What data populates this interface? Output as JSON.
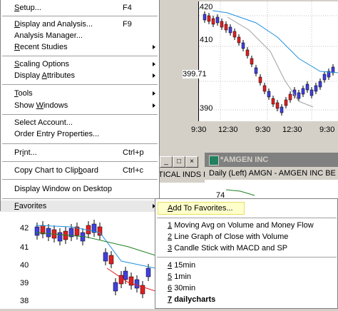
{
  "colors": {
    "up": "#4040e0",
    "down": "#e02020",
    "ma_fast": "#2090e0",
    "ma_slow": "#a0a0a0",
    "ma_green": "#208020",
    "highlight": "#ffffcc"
  },
  "chart_top": {
    "y_ticks": [
      "420",
      "410",
      "399.71",
      "390"
    ],
    "x_ticks": [
      "9:30",
      "12:30",
      "9:30",
      "12:30",
      "9:30"
    ]
  },
  "chart_bl": {
    "y_ticks": [
      "42",
      "41",
      "40",
      "39",
      "38"
    ]
  },
  "amgen": {
    "title": "*AMGEN INC",
    "sub": "Daily  (Left)    AMGN - AMGEN INC  BE",
    "value": "74"
  },
  "mid_window": {
    "label": "TICAL INDS L",
    "controls": [
      "_",
      "□",
      "×"
    ]
  },
  "menu": {
    "items": [
      {
        "label": "Setup...",
        "shortcut": "F4",
        "u": "S"
      },
      {
        "label": "Display and Analysis...",
        "shortcut": "F9",
        "u": "D"
      },
      {
        "label": "Analysis Manager...",
        "shortcut": "",
        "u": ""
      },
      {
        "label": "Recent Studies",
        "shortcut": "",
        "u": "R",
        "arrow": true
      },
      {
        "label": "Scaling Options",
        "shortcut": "",
        "u": "S",
        "arrow": true
      },
      {
        "label": "Display Attributes",
        "shortcut": "",
        "u": "A",
        "arrow": true
      },
      {
        "label": "Tools",
        "shortcut": "",
        "u": "T",
        "arrow": true
      },
      {
        "label": "Show Windows",
        "shortcut": "",
        "u": "W",
        "arrow": true
      },
      {
        "label": "Select Account...",
        "shortcut": "",
        "u": ""
      },
      {
        "label": "Order Entry Properties...",
        "shortcut": "",
        "u": ""
      },
      {
        "label": "Print...",
        "shortcut": "Ctrl+p",
        "u": "i"
      },
      {
        "label": "Copy Chart to Clipboard",
        "shortcut": "Ctrl+c",
        "u": "b"
      },
      {
        "label": "Display Window on Desktop",
        "shortcut": "",
        "u": ""
      },
      {
        "label": "Favorites",
        "shortcut": "",
        "u": "F",
        "arrow": true
      }
    ]
  },
  "favorites": {
    "add": "Add To Favorites...",
    "items": [
      {
        "num": "1",
        "label": "Moving Avg on Volume and Money Flow"
      },
      {
        "num": "2",
        "label": "Line Graph of Close with Volume"
      },
      {
        "num": "3",
        "label": "Candle Stick with MACD and SP"
      },
      {
        "num": "4",
        "label": "15min"
      },
      {
        "num": "5",
        "label": "1min"
      },
      {
        "num": "6",
        "label": "30min"
      },
      {
        "num": "7",
        "label": "dailycharts",
        "bold": true
      }
    ]
  }
}
